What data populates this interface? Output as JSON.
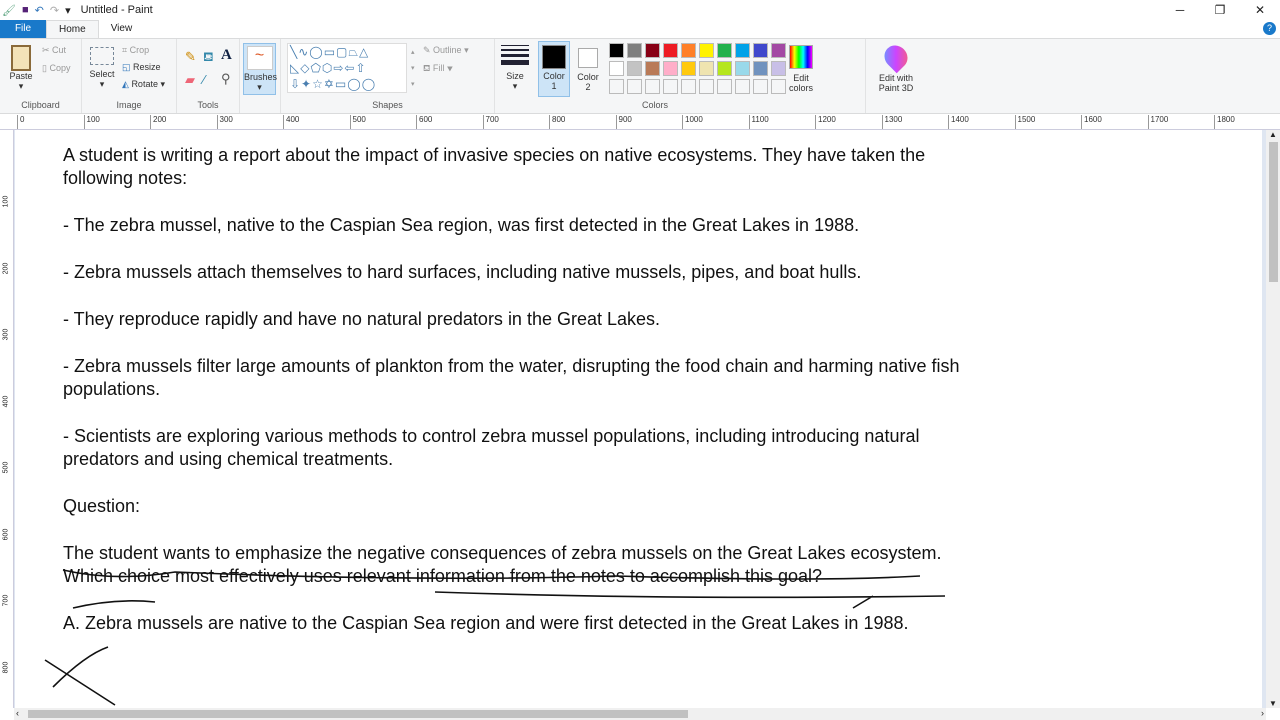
{
  "window": {
    "title": "Untitled - Paint",
    "minimize": "─",
    "restore": "❐",
    "close": "✕"
  },
  "tabs": [
    {
      "label": "File"
    },
    {
      "label": "Home"
    },
    {
      "label": "View"
    }
  ],
  "ribbon": {
    "clipboard": {
      "label": "Clipboard",
      "paste": "Paste",
      "cut": "Cut",
      "copy": "Copy"
    },
    "image": {
      "label": "Image",
      "select": "Select",
      "crop": "Crop",
      "resize": "Resize",
      "rotate": "Rotate"
    },
    "tools": {
      "label": "Tools"
    },
    "brushes": "Brushes",
    "shapes": {
      "label": "Shapes",
      "outline": "Outline",
      "fill": "Fill"
    },
    "size": "Size",
    "color1": {
      "label": "Color",
      "num": "1",
      "value": "#000000"
    },
    "color2": {
      "label": "Color",
      "num": "2",
      "value": "#ffffff"
    },
    "colors": {
      "label": "Colors",
      "palette_row1": [
        "#000000",
        "#7f7f7f",
        "#880015",
        "#ed1c24",
        "#ff7f27",
        "#fff200",
        "#22b14c",
        "#00a2e8",
        "#3f48cc",
        "#a349a4"
      ],
      "palette_row2": [
        "#ffffff",
        "#c3c3c3",
        "#b97a57",
        "#ffaec9",
        "#ffc90e",
        "#efe4b0",
        "#b5e61d",
        "#99d9ea",
        "#7092be",
        "#c8bfe7"
      ]
    },
    "edit_colors": "Edit colors",
    "paint3d": "Edit with Paint 3D"
  },
  "ruler": {
    "h": [
      "0",
      "100",
      "200",
      "300",
      "400",
      "500",
      "600",
      "700",
      "800",
      "900",
      "1000",
      "1100",
      "1200",
      "1300",
      "1400",
      "1500",
      "1600",
      "1700",
      "1800"
    ],
    "v": [
      "100",
      "200",
      "300",
      "400",
      "500",
      "600",
      "700",
      "800"
    ]
  },
  "document": {
    "paragraphs": [
      "A student is writing a report about the impact of invasive species on native ecosystems. They have taken the following notes:",
      "- The zebra mussel, native to the Caspian Sea region, was first detected in the Great Lakes in 1988.",
      "- Zebra mussels attach themselves to hard surfaces, including native mussels, pipes, and boat hulls.",
      "- They reproduce rapidly and have no natural predators in the Great Lakes.",
      "- Zebra mussels filter large amounts of plankton from the water, disrupting the food chain and harming native fish populations.",
      "- Scientists are exploring various methods to control zebra mussel populations, including introducing natural predators and using chemical treatments.",
      "",
      "Question:",
      "The student wants to emphasize the negative consequences of zebra mussels on the Great Lakes ecosystem. Which choice most effectively uses relevant information from the notes to accomplish this goal?",
      "A. Zebra mussels are native to the Caspian Sea region and were first detected in the Great Lakes in 1988."
    ]
  }
}
